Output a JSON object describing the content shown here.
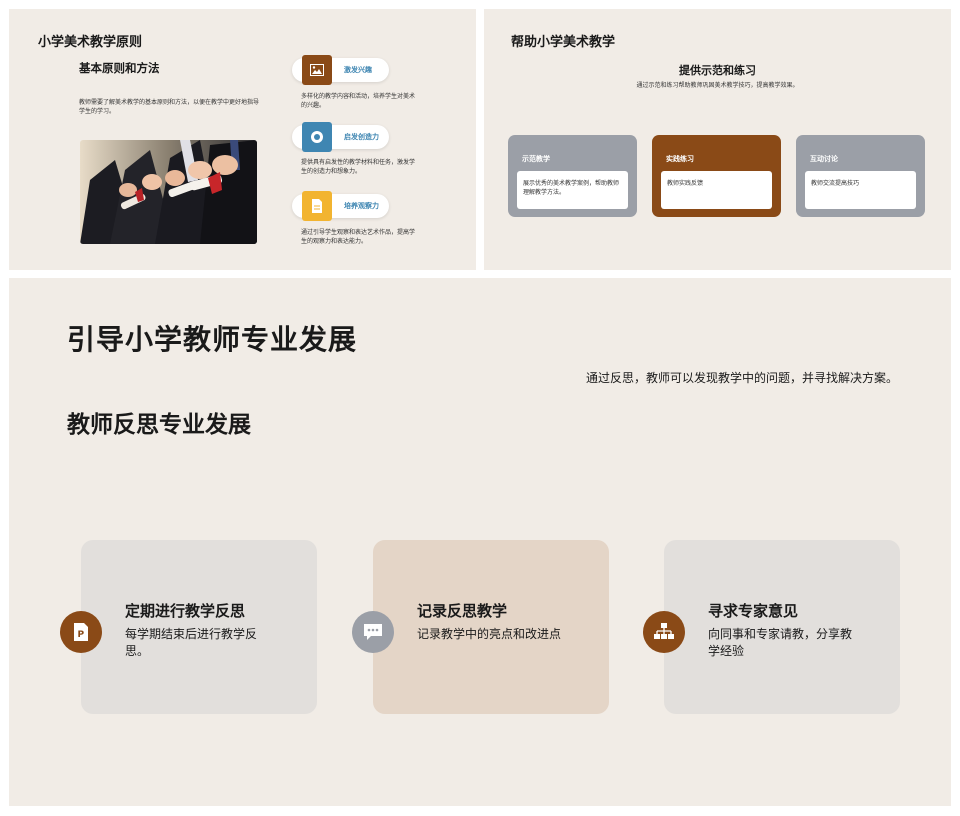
{
  "slide1": {
    "title": "小学美术教学原则",
    "subtitle": "基本原则和方法",
    "description": "教师需要了解美术教学的基本原则和方法，以便在教学中更好地指导学生的学习。",
    "items": [
      {
        "label": "激发兴趣",
        "description": "多样化的教学内容和活动，培养学生对美术的兴趣。",
        "icon": "image-icon",
        "color": "#8a4a17"
      },
      {
        "label": "启发创造力",
        "description": "提供具有启发性的教学材料和任务，激发学生的创造力和想象力。",
        "icon": "target-icon",
        "color": "#3f86b2"
      },
      {
        "label": "培养观察力",
        "description": "通过引导学生观察和表达艺术作品，提高学生的观察力和表达能力。",
        "icon": "document-icon",
        "color": "#f2b430"
      }
    ]
  },
  "slide2": {
    "title": "帮助小学美术教学",
    "subtitle": "提供示范和练习",
    "description": "通过示范和练习帮助教师巩固美术教学技巧，提高教学效果。",
    "cards": [
      {
        "label": "示范教学",
        "text": "展示优秀的美术教学案例，帮助教师理解教学方法。",
        "color": "#9b9fa7"
      },
      {
        "label": "实践练习",
        "text": "教师实践反馈",
        "color": "#8a4a17"
      },
      {
        "label": "互动讨论",
        "text": "教师交流提高技巧",
        "color": "#9b9fa7"
      }
    ]
  },
  "slide3": {
    "title": "引导小学教师专业发展",
    "description": "通过反思，教师可以发现教学中的问题，并寻找解决方案。",
    "subtitle": "教师反思专业发展",
    "boxes": [
      {
        "title": "定期进行教学反思",
        "text": "每学期结束后进行教学反思。",
        "icon": "presentation-icon",
        "box_color": "#e2dfdc",
        "circle_color": "#8a4a17"
      },
      {
        "title": "记录反思教学",
        "text": "记录教学中的亮点和改进点",
        "icon": "chat-icon",
        "box_color": "#e4d5c7",
        "circle_color": "#9b9fa7"
      },
      {
        "title": "寻求专家意见",
        "text": "向同事和专家请教，分享教学经验",
        "icon": "hierarchy-icon",
        "box_color": "#e2dfdc",
        "circle_color": "#8a4a17"
      }
    ]
  },
  "colors": {
    "background": "#f1ece6",
    "accent": "#8a4a17",
    "label_blue": "#3f86b2"
  }
}
